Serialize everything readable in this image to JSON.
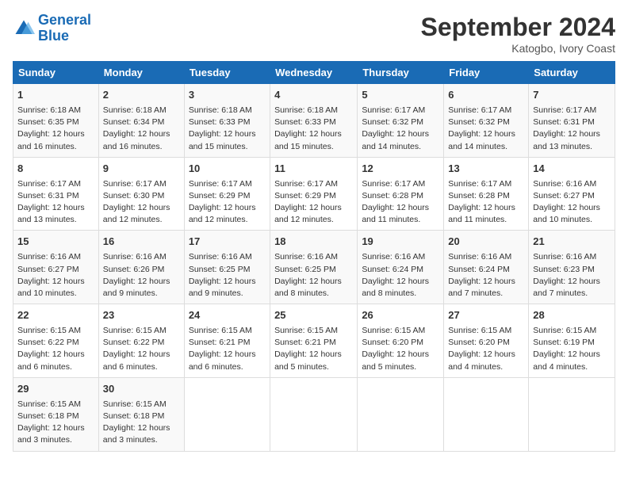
{
  "header": {
    "logo_line1": "General",
    "logo_line2": "Blue",
    "title": "September 2024",
    "subtitle": "Katogbo, Ivory Coast"
  },
  "days_of_week": [
    "Sunday",
    "Monday",
    "Tuesday",
    "Wednesday",
    "Thursday",
    "Friday",
    "Saturday"
  ],
  "weeks": [
    [
      {
        "num": "1",
        "sunrise": "6:18 AM",
        "sunset": "6:35 PM",
        "daylight": "12 hours and 16 minutes."
      },
      {
        "num": "2",
        "sunrise": "6:18 AM",
        "sunset": "6:34 PM",
        "daylight": "12 hours and 16 minutes."
      },
      {
        "num": "3",
        "sunrise": "6:18 AM",
        "sunset": "6:33 PM",
        "daylight": "12 hours and 15 minutes."
      },
      {
        "num": "4",
        "sunrise": "6:18 AM",
        "sunset": "6:33 PM",
        "daylight": "12 hours and 15 minutes."
      },
      {
        "num": "5",
        "sunrise": "6:17 AM",
        "sunset": "6:32 PM",
        "daylight": "12 hours and 14 minutes."
      },
      {
        "num": "6",
        "sunrise": "6:17 AM",
        "sunset": "6:32 PM",
        "daylight": "12 hours and 14 minutes."
      },
      {
        "num": "7",
        "sunrise": "6:17 AM",
        "sunset": "6:31 PM",
        "daylight": "12 hours and 13 minutes."
      }
    ],
    [
      {
        "num": "8",
        "sunrise": "6:17 AM",
        "sunset": "6:31 PM",
        "daylight": "12 hours and 13 minutes."
      },
      {
        "num": "9",
        "sunrise": "6:17 AM",
        "sunset": "6:30 PM",
        "daylight": "12 hours and 12 minutes."
      },
      {
        "num": "10",
        "sunrise": "6:17 AM",
        "sunset": "6:29 PM",
        "daylight": "12 hours and 12 minutes."
      },
      {
        "num": "11",
        "sunrise": "6:17 AM",
        "sunset": "6:29 PM",
        "daylight": "12 hours and 12 minutes."
      },
      {
        "num": "12",
        "sunrise": "6:17 AM",
        "sunset": "6:28 PM",
        "daylight": "12 hours and 11 minutes."
      },
      {
        "num": "13",
        "sunrise": "6:17 AM",
        "sunset": "6:28 PM",
        "daylight": "12 hours and 11 minutes."
      },
      {
        "num": "14",
        "sunrise": "6:16 AM",
        "sunset": "6:27 PM",
        "daylight": "12 hours and 10 minutes."
      }
    ],
    [
      {
        "num": "15",
        "sunrise": "6:16 AM",
        "sunset": "6:27 PM",
        "daylight": "12 hours and 10 minutes."
      },
      {
        "num": "16",
        "sunrise": "6:16 AM",
        "sunset": "6:26 PM",
        "daylight": "12 hours and 9 minutes."
      },
      {
        "num": "17",
        "sunrise": "6:16 AM",
        "sunset": "6:25 PM",
        "daylight": "12 hours and 9 minutes."
      },
      {
        "num": "18",
        "sunrise": "6:16 AM",
        "sunset": "6:25 PM",
        "daylight": "12 hours and 8 minutes."
      },
      {
        "num": "19",
        "sunrise": "6:16 AM",
        "sunset": "6:24 PM",
        "daylight": "12 hours and 8 minutes."
      },
      {
        "num": "20",
        "sunrise": "6:16 AM",
        "sunset": "6:24 PM",
        "daylight": "12 hours and 7 minutes."
      },
      {
        "num": "21",
        "sunrise": "6:16 AM",
        "sunset": "6:23 PM",
        "daylight": "12 hours and 7 minutes."
      }
    ],
    [
      {
        "num": "22",
        "sunrise": "6:15 AM",
        "sunset": "6:22 PM",
        "daylight": "12 hours and 6 minutes."
      },
      {
        "num": "23",
        "sunrise": "6:15 AM",
        "sunset": "6:22 PM",
        "daylight": "12 hours and 6 minutes."
      },
      {
        "num": "24",
        "sunrise": "6:15 AM",
        "sunset": "6:21 PM",
        "daylight": "12 hours and 6 minutes."
      },
      {
        "num": "25",
        "sunrise": "6:15 AM",
        "sunset": "6:21 PM",
        "daylight": "12 hours and 5 minutes."
      },
      {
        "num": "26",
        "sunrise": "6:15 AM",
        "sunset": "6:20 PM",
        "daylight": "12 hours and 5 minutes."
      },
      {
        "num": "27",
        "sunrise": "6:15 AM",
        "sunset": "6:20 PM",
        "daylight": "12 hours and 4 minutes."
      },
      {
        "num": "28",
        "sunrise": "6:15 AM",
        "sunset": "6:19 PM",
        "daylight": "12 hours and 4 minutes."
      }
    ],
    [
      {
        "num": "29",
        "sunrise": "6:15 AM",
        "sunset": "6:18 PM",
        "daylight": "12 hours and 3 minutes."
      },
      {
        "num": "30",
        "sunrise": "6:15 AM",
        "sunset": "6:18 PM",
        "daylight": "12 hours and 3 minutes."
      },
      null,
      null,
      null,
      null,
      null
    ]
  ]
}
